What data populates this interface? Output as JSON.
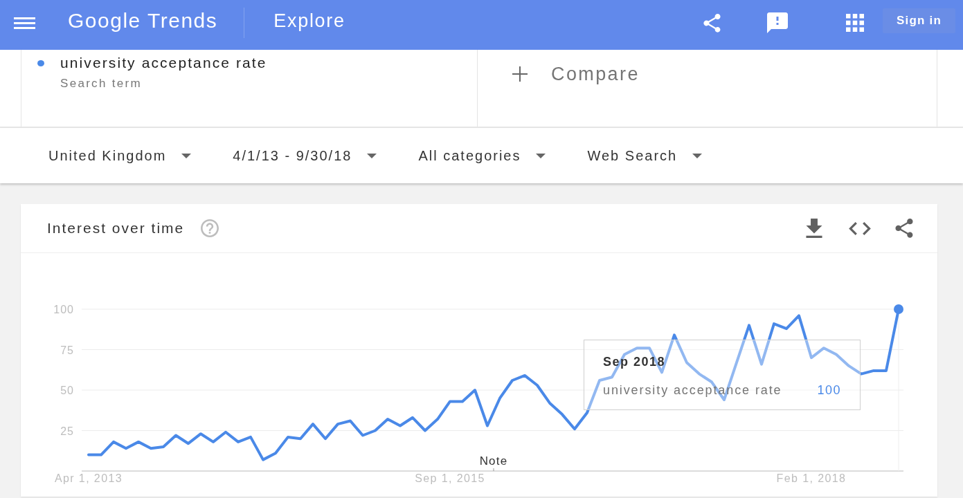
{
  "top_bar": {
    "logo": "Google Trends",
    "title": "Explore",
    "sign_in": "Sign in"
  },
  "search_terms": [
    {
      "term": "university acceptance rate",
      "caption": "Search term",
      "color": "#4a89e8"
    }
  ],
  "compare": {
    "label": "Compare"
  },
  "filters": [
    "United Kingdom",
    "4/1/13 - 9/30/18",
    "All categories",
    "Web Search"
  ],
  "interest_over_time": {
    "title": "Interest over time",
    "chart_data": {
      "type": "line",
      "categories": [
        "Apr 1, 2013",
        null,
        null,
        null,
        null,
        null,
        null,
        null,
        null,
        null,
        null,
        null,
        null,
        null,
        null,
        null,
        null,
        null,
        null,
        null,
        null,
        null,
        null,
        null,
        null,
        null,
        null,
        null,
        null,
        "Sep 1, 2015",
        null,
        null,
        null,
        null,
        null,
        null,
        null,
        null,
        null,
        null,
        null,
        null,
        null,
        null,
        null,
        null,
        null,
        null,
        null,
        null,
        null,
        null,
        null,
        null,
        null,
        null,
        null,
        null,
        "Feb 1, 2018",
        null,
        null,
        null,
        null,
        null,
        null,
        null
      ],
      "series": [
        {
          "name": "university acceptance rate",
          "color": "#4a89e8",
          "values": [
            10,
            10,
            18,
            14,
            18,
            14,
            15,
            22,
            17,
            23,
            18,
            24,
            18,
            21,
            7,
            11,
            21,
            20,
            29,
            20,
            29,
            31,
            22,
            25,
            32,
            28,
            33,
            25,
            32,
            43,
            43,
            50,
            28,
            45,
            56,
            59,
            53,
            42,
            35,
            26,
            36,
            56,
            58,
            72,
            76,
            76,
            61,
            84,
            67,
            60,
            55,
            44,
            67,
            90,
            66,
            91,
            88,
            96,
            70,
            76,
            72,
            65,
            60,
            62,
            62,
            100
          ]
        }
      ],
      "ylim": [
        0,
        100
      ],
      "yticks": [
        25,
        50,
        75,
        100
      ],
      "grid": true,
      "annotations": [
        "Note"
      ]
    },
    "tooltip": {
      "date": "Sep 2018",
      "value": "100"
    }
  }
}
